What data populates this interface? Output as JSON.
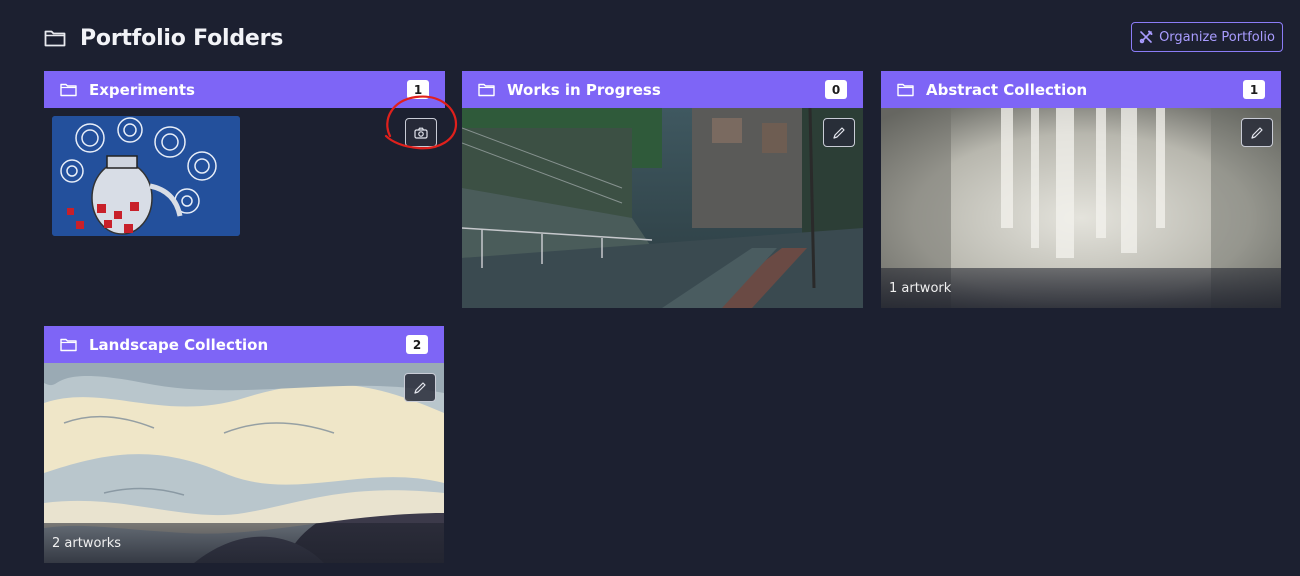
{
  "page": {
    "title": "Portfolio Folders",
    "organize_label": "Organize Portfolio"
  },
  "folders": [
    {
      "name": "Experiments",
      "count": "1",
      "action_icon": "camera-icon",
      "caption": ""
    },
    {
      "name": "Works in Progress",
      "count": "0",
      "action_icon": "pencil-icon",
      "caption": ""
    },
    {
      "name": "Abstract Collection",
      "count": "1",
      "action_icon": "pencil-icon",
      "caption": "1 artwork"
    },
    {
      "name": "Landscape Collection",
      "count": "2",
      "action_icon": "pencil-icon",
      "caption": "2 artworks"
    }
  ],
  "colors": {
    "background": "#1c2030",
    "header_purple": "#7e65f6",
    "accent": "#a99cff",
    "annotation": "#e0201c"
  }
}
